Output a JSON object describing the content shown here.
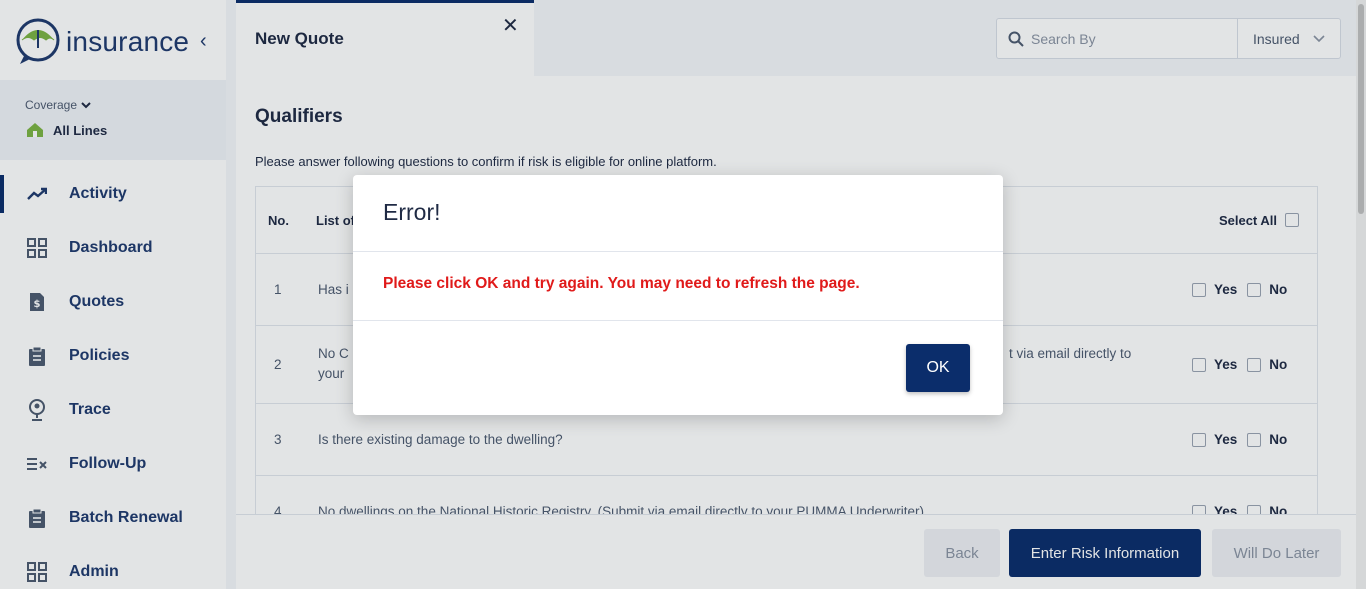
{
  "app": {
    "brand": "insurance",
    "coverage_label": "Coverage",
    "coverage_value": "All Lines"
  },
  "nav": {
    "items": [
      {
        "label": "Activity",
        "icon": "trending-up-icon",
        "active": true
      },
      {
        "label": "Dashboard",
        "icon": "grid-icon"
      },
      {
        "label": "Quotes",
        "icon": "dollar-document-icon"
      },
      {
        "label": "Policies",
        "icon": "clipboard-icon"
      },
      {
        "label": "Trace",
        "icon": "location-pin-icon"
      },
      {
        "label": "Follow-Up",
        "icon": "checklist-icon"
      },
      {
        "label": "Batch Renewal",
        "icon": "clipboard-list-icon"
      },
      {
        "label": "Admin",
        "icon": "grid-icon"
      }
    ]
  },
  "header": {
    "tab_title": "New Quote",
    "search_placeholder": "Search By",
    "search_filter": "Insured"
  },
  "qualifiers": {
    "title": "Qualifiers",
    "description": "Please answer following questions to confirm if risk is eligible for online platform.",
    "col_no": "No.",
    "col_list": "List of",
    "select_all": "Select All",
    "yes": "Yes",
    "no": "No",
    "rows": [
      {
        "no": "1",
        "text": "Has i"
      },
      {
        "no": "2",
        "text": "No C",
        "text_tail": "t via email directly to",
        "text_line2": "your"
      },
      {
        "no": "3",
        "text": "Is there existing damage to the dwelling?"
      },
      {
        "no": "4",
        "text": "No dwellings on the National Historic Registry. (Submit via email directly to your PUMMA Underwriter)"
      }
    ]
  },
  "footer": {
    "back": "Back",
    "enter": "Enter Risk Information",
    "later": "Will Do Later"
  },
  "modal": {
    "title": "Error!",
    "message": "Please click OK and try again. You may need to refresh the page.",
    "ok": "OK"
  },
  "colors": {
    "primary": "#0b2d6b",
    "error": "#e01a1a",
    "brand_green": "#7cb342"
  }
}
